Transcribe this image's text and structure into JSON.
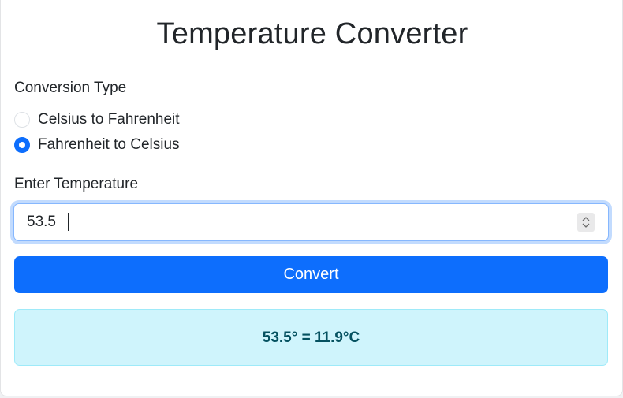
{
  "title": "Temperature Converter",
  "conversion": {
    "label": "Conversion Type",
    "options": [
      {
        "label": "Celsius to Fahrenheit",
        "selected": false
      },
      {
        "label": "Fahrenheit to Celsius",
        "selected": true
      }
    ]
  },
  "temperature": {
    "label": "Enter Temperature",
    "value": "53.5"
  },
  "convert_button": {
    "label": "Convert"
  },
  "result": {
    "text": "53.5° = 11.9°C"
  },
  "colors": {
    "primary": "#0d6efd",
    "result_bg": "#cff4fc",
    "result_text": "#055160",
    "result_border": "#9eeaf9"
  }
}
